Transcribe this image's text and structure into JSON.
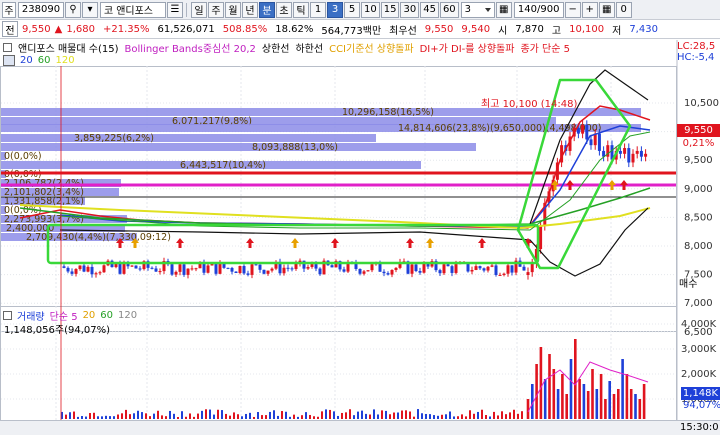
{
  "toolbar": {
    "stock_code": "238090",
    "market_prefix": "코",
    "stock_name": "앤디포스",
    "label_ju": "주",
    "label_jeon": "전",
    "periods": [
      "일",
      "주",
      "월",
      "년",
      "분",
      "초",
      "틱",
      "1",
      "3",
      "5",
      "10",
      "15",
      "30",
      "45",
      "60"
    ],
    "active_period": "분",
    "active_minute": "3",
    "minute_input": "3",
    "count_display": "140/900",
    "chart_num": "0"
  },
  "quote": {
    "price": "9,550",
    "change": "1,680",
    "change_pct": "+21.35%",
    "volume": "61,526,071",
    "vol_ratio": "508.85%",
    "turnover": "18.62%",
    "amount": "564,773백만",
    "best_ask_label": "최우선",
    "ask": "9,550",
    "bid": "9,540",
    "high_label": "시",
    "high": "7,870",
    "go_label": "고",
    "high_price": "10,100",
    "low_label": "저",
    "low_price": "7,430"
  },
  "legend": {
    "title": "앤디포스 매물대 수(15)",
    "bollinger": "Bollinger Bands중심선 20,2",
    "upper": "상한선",
    "lower": "하한선",
    "cci": "CCI기준선 상향돌파",
    "di": "DI+가 DI-를 상향돌파",
    "ma_label": "종가 단순 5",
    "ma_periods": [
      "20",
      "60",
      "120"
    ],
    "lc_label": "LC:28,5",
    "hc_label": "HC:-5,4"
  },
  "volume_profile": [
    {
      "label": "10,296,158(16,5%)"
    },
    {
      "label": "6,071,217(9,8%)"
    },
    {
      "label": "14,814,606(23,8%)(9,650,000)(4,498,000)"
    },
    {
      "label": "3,859,225(6,2%)"
    },
    {
      "label": "8,093,888(13,0%)"
    },
    {
      "label": "0(0,0%)"
    },
    {
      "label": "6,443,517(10,4%)"
    },
    {
      "label": "0(0,0%)"
    },
    {
      "label": "2,106,782(2,4%)"
    },
    {
      "label": "2,101,802(3,4%)"
    },
    {
      "label": "1,331,858(2,1%)"
    },
    {
      "label": "0(0,0%)"
    },
    {
      "label": "2,273,993(3,7%)"
    },
    {
      "label": "2,400,000"
    },
    {
      "label": "2,709,430(4,4%)(7,330,09:12)"
    }
  ],
  "annotations": {
    "high_note": "최고 10,100 (14:48)"
  },
  "price_axis": [
    "10,500",
    "10,000",
    "9,500",
    "9,000",
    "8,500",
    "8,000",
    "7,500",
    "7,000",
    "6,500"
  ],
  "current_price_tag": "9,550",
  "current_pct_tag": "0,21%",
  "side_label": "매수",
  "volume_axis": [
    "4,000K",
    "3,000K",
    "2,000K",
    "1,000K"
  ],
  "volume_tag": "1,148K",
  "volume_pct": "94,07%",
  "volume_legend": {
    "title": "거래량",
    "ma": "단순 5",
    "periods": [
      "20",
      "60",
      "120"
    ],
    "value": "1,148,056주(94,07%)"
  },
  "dates": [
    "09/14",
    "09/15",
    "10",
    "11",
    "12",
    "13",
    "14",
    "15"
  ],
  "time": "15:30:0",
  "colors": {
    "up": "#e0141e",
    "down": "#1e40d8",
    "profile": "#8c8ce8",
    "highlight": "#39d839",
    "magenta": "#e020c8",
    "ma5": "#e0141e",
    "ma20": "#1e40d8",
    "ma60": "#25a025",
    "ma120": "#e0e020"
  }
}
